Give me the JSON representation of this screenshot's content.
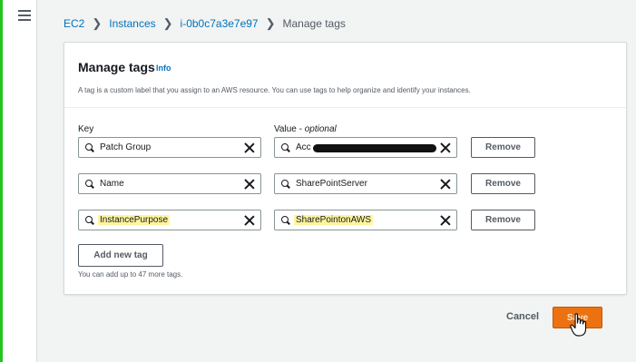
{
  "breadcrumb": {
    "ec2": "EC2",
    "instances": "Instances",
    "instance_id": "i-0b0c7a3e7e97",
    "current": "Manage tags"
  },
  "panel": {
    "title": "Manage tags",
    "info": "Info",
    "description": "A tag is a custom label that you assign to an AWS resource. You can use tags to help organize and identify your instances.",
    "key_label": "Key",
    "value_label": "Value - ",
    "value_optional": "optional"
  },
  "tags": [
    {
      "key": "Patch Group",
      "value": "Acc",
      "value_redacted": true,
      "remove": "Remove"
    },
    {
      "key": "Name",
      "value": "SharePointServer",
      "remove": "Remove"
    },
    {
      "key": "InstancePurpose",
      "value": "SharePointonAWS",
      "remove": "Remove",
      "highlight": true
    }
  ],
  "add_tag_label": "Add new tag",
  "hint": "You can add up to 47 more tags.",
  "actions": {
    "cancel": "Cancel",
    "save": "Save"
  },
  "colors": {
    "link": "#0073bb",
    "primary": "#ec7211",
    "highlight": "#fff59d",
    "frame": "#22c51f"
  }
}
